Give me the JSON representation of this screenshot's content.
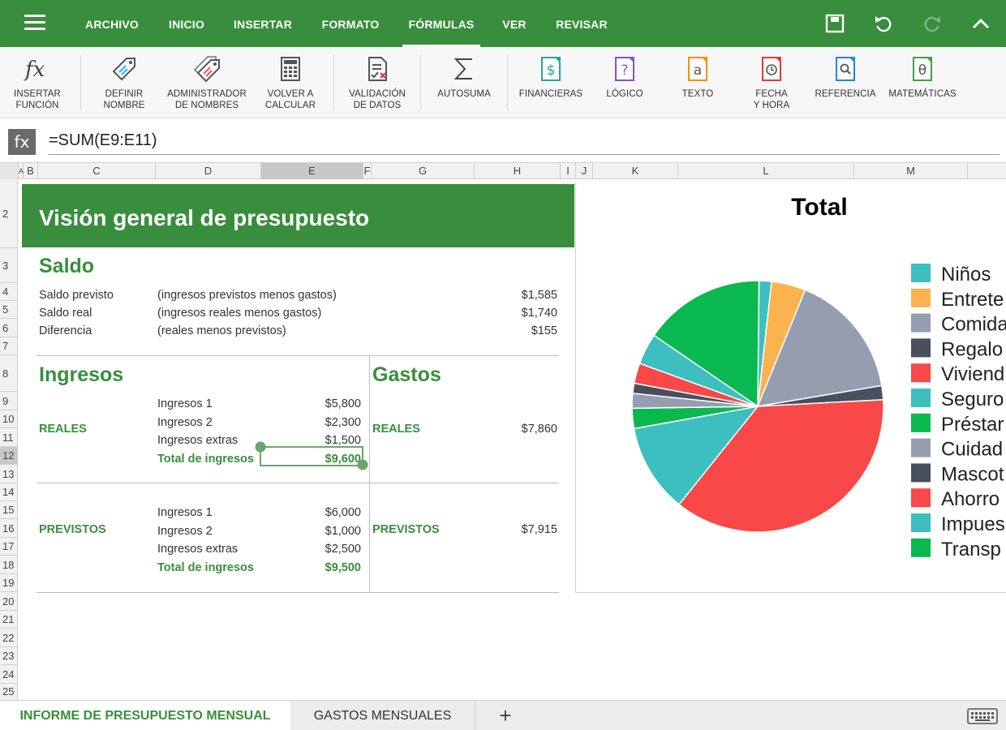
{
  "topbar": {
    "tabs": [
      "ARCHIVO",
      "INICIO",
      "INSERTAR",
      "FORMATO",
      "FÓRMULAS",
      "VER",
      "REVISAR"
    ],
    "active_tab": "FÓRMULAS",
    "icons": [
      "menu-icon",
      "save-icon",
      "undo-icon",
      "redo-icon",
      "collapse-icon"
    ],
    "accent_color": "#388e3c"
  },
  "ribbon": {
    "items": [
      {
        "line1": "INSERTAR",
        "line2": "FUNCIÓN",
        "icon": "fx-icon"
      },
      {
        "line1": "DEFINIR",
        "line2": "NOMBRE",
        "icon": "tag-icon"
      },
      {
        "line1": "ADMINISTRADOR",
        "line2": "DE NOMBRES",
        "icon": "tags-icon"
      },
      {
        "line1": "VOLVER A",
        "line2": "CALCULAR",
        "icon": "calculator-icon"
      },
      {
        "line1": "VALIDACIÓN",
        "line2": "DE DATOS",
        "icon": "data-validation-icon"
      },
      {
        "line1": "AUTOSUMA",
        "line2": "",
        "icon": "sigma-icon"
      },
      {
        "line1": "FINANCIERAS",
        "line2": "",
        "icon": "dollar-icon"
      },
      {
        "line1": "LÓGICO",
        "line2": "",
        "icon": "question-icon"
      },
      {
        "line1": "TEXTO",
        "line2": "",
        "icon": "text-icon"
      },
      {
        "line1": "FECHA",
        "line2": "Y HORA",
        "icon": "clock-icon"
      },
      {
        "line1": "REFERENCIA",
        "line2": "",
        "icon": "magnifier-icon"
      },
      {
        "line1": "MATEMÁTICAS",
        "line2": "",
        "icon": "theta-icon"
      }
    ]
  },
  "formula_bar": {
    "label": "fx",
    "formula": "=SUM(E9:E11)"
  },
  "grid": {
    "columns": [
      "A",
      "B",
      "C",
      "D",
      "E",
      "F",
      "G",
      "H",
      "I",
      "J",
      "K",
      "L",
      "M"
    ],
    "selected_column": "E",
    "rows": [
      "2",
      "3",
      "4",
      "5",
      "6",
      "7",
      "8",
      "9",
      "10",
      "11",
      "12",
      "13",
      "14",
      "15",
      "16",
      "17",
      "18",
      "19",
      "20",
      "21",
      "22",
      "23",
      "24",
      "25"
    ],
    "selected_row": "12"
  },
  "sheet": {
    "title": "Visión general de presupuesto",
    "saldo": {
      "heading": "Saldo",
      "rows": [
        {
          "label": "Saldo previsto",
          "desc": "(ingresos previstos menos gastos)",
          "value": "$1,585"
        },
        {
          "label": "Saldo real",
          "desc": "(ingresos reales menos gastos)",
          "value": "$1,740"
        },
        {
          "label": "Diferencia",
          "desc": "(reales menos previstos)",
          "value": "$155"
        }
      ]
    },
    "ingresos": {
      "heading": "Ingresos",
      "reales_label": "REALES",
      "reales": [
        {
          "label": "Ingresos 1",
          "value": "$5,800"
        },
        {
          "label": "Ingresos 2",
          "value": "$2,300"
        },
        {
          "label": "Ingresos extras",
          "value": "$1,500"
        }
      ],
      "reales_total_label": "Total de ingresos",
      "reales_total": "$9,600",
      "previstos_label": "PREVISTOS",
      "previstos": [
        {
          "label": "Ingresos 1",
          "value": "$6,000"
        },
        {
          "label": "Ingresos 2",
          "value": "$1,000"
        },
        {
          "label": "Ingresos extras",
          "value": "$2,500"
        }
      ],
      "previstos_total_label": "Total de ingresos",
      "previstos_total": "$9,500"
    },
    "gastos": {
      "heading": "Gastos",
      "reales_label": "REALES",
      "reales_value": "$7,860",
      "previstos_label": "PREVISTOS",
      "previstos_value": "$7,915"
    }
  },
  "chart_data": {
    "type": "pie",
    "title": "Total",
    "legend_position": "right",
    "labels": [
      "Niños",
      "Entrete",
      "Comida",
      "Regalo",
      "Viviend",
      "Seguro",
      "Préstar",
      "Cuidad",
      "Mascot",
      "Ahorro",
      "Impues",
      "Transp"
    ],
    "colors": [
      "#3dbfbf",
      "#fbb24f",
      "#959eb0",
      "#4a4f5e",
      "#f84848",
      "#3dbfbf",
      "#0ab850",
      "#959eb0",
      "#4a4f5e",
      "#f84848",
      "#3dbfbf",
      "#0ab850"
    ],
    "values": [
      1.6,
      4.4,
      16.2,
      1.8,
      36.6,
      11.4,
      2.6,
      1.9,
      1.3,
      2.6,
      4.0,
      15.6
    ]
  },
  "sheet_tabs": {
    "tabs": [
      "INFORME DE PRESUPUESTO MENSUAL",
      "GASTOS MENSUALES"
    ],
    "active": "INFORME DE PRESUPUESTO MENSUAL",
    "add_label": "+"
  }
}
